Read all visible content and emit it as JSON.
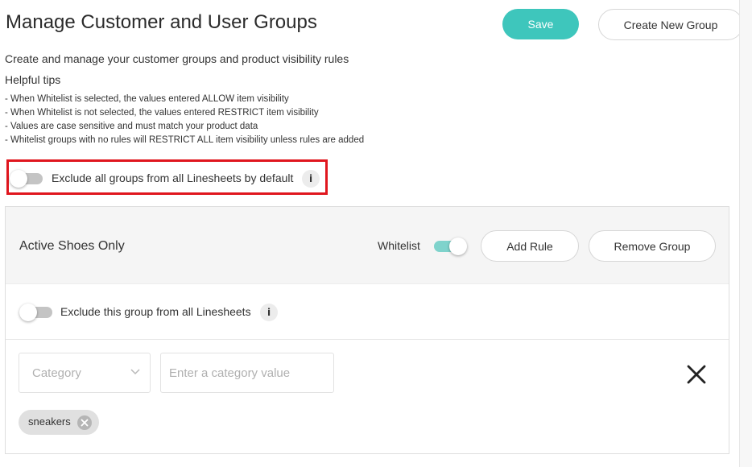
{
  "header": {
    "title": "Manage Customer and User Groups",
    "save_label": "Save",
    "create_label": "Create New Group"
  },
  "intro": {
    "subtitle": "Create and manage your customer groups and product visibility rules",
    "tips_title": "Helpful tips",
    "tips": [
      "- When Whitelist is selected, the values entered ALLOW item visibility",
      "- When Whitelist is not selected, the values entered RESTRICT item visibility",
      "- Values are case sensitive and must match your product data",
      "- Whitelist groups with no rules will RESTRICT ALL item visibility unless rules are added"
    ]
  },
  "global_toggle": {
    "label": "Exclude all groups from all Linesheets by default",
    "enabled": false,
    "info_glyph": "i"
  },
  "group": {
    "name": "Active Shoes Only",
    "whitelist_label": "Whitelist",
    "whitelist_enabled": true,
    "add_rule_label": "Add Rule",
    "remove_group_label": "Remove Group",
    "exclude_label": "Exclude this group from all Linesheets",
    "exclude_enabled": false,
    "info_glyph": "i",
    "rule": {
      "select_value": "Category",
      "input_placeholder": "Enter a category value",
      "chips": [
        "sneakers"
      ]
    }
  },
  "colors": {
    "accent": "#3ec6bc",
    "highlight": "#e0161e",
    "toggle_on": "#7fd3cc",
    "toggle_off": "#c4c4c4"
  },
  "icons": {
    "info": "info-icon",
    "chevron": "chevron-down-icon",
    "close": "close-icon",
    "chip_remove": "remove-chip-icon"
  }
}
